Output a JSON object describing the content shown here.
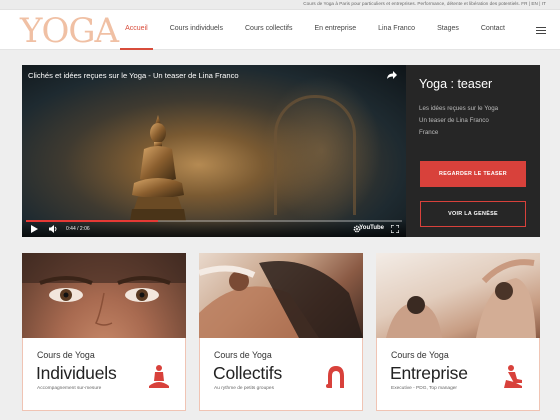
{
  "topbar": {
    "tagline": "Cours de Yoga à Paris pour particuliers et entreprises. Performance, détente et libération des potentiels. FR | EN | IT"
  },
  "header": {
    "logo": "YOGA",
    "nav": [
      "Accueil",
      "Cours individuels",
      "Cours collectifs",
      "En entreprise",
      "Lina Franco",
      "Stages",
      "Contact"
    ],
    "active_item": "Accueil"
  },
  "video": {
    "title": "Clichés et idées reçues sur le Yoga - Un teaser de Lina Franco",
    "current_time": "0:44 / 2:06",
    "progress_fraction": 0.35,
    "brand": "YouTube"
  },
  "side": {
    "title": "Yoga : teaser",
    "lines": [
      "Les idées reçues sur le Yoga",
      "Un teaser de Lina Franco",
      "France"
    ],
    "primary_button": "REGARDER LE TEASER",
    "secondary_button": "VOIR LA GENÈSE"
  },
  "cards": [
    {
      "pre": "Cours de Yoga",
      "main": "Individuels",
      "sub": "Accompagnement sur-mesure",
      "icon": "seated-meditation-icon"
    },
    {
      "pre": "Cours de Yoga",
      "main": "Collectifs",
      "sub": "Au rythme de petits groupes",
      "icon": "backbend-pose-icon"
    },
    {
      "pre": "Cours de Yoga",
      "main": "Entreprise",
      "sub": "Executive - PDG, Top manager",
      "icon": "kneeling-pose-icon"
    }
  ],
  "colors": {
    "accent": "#d84c3b",
    "logo": "#f0c0a4",
    "dark_panel": "#262626"
  }
}
